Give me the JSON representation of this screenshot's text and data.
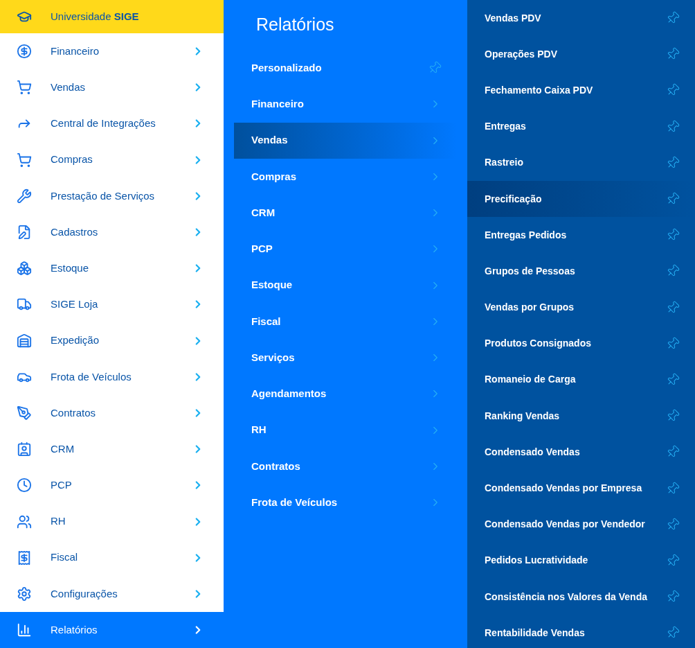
{
  "sidebar": {
    "header": {
      "label": "Universidade **SIGE**"
    },
    "items": [
      {
        "label": "Financeiro",
        "selected": false
      },
      {
        "label": "Vendas",
        "selected": false
      },
      {
        "label": "Central de Integrações",
        "selected": false
      },
      {
        "label": "Compras",
        "selected": false
      },
      {
        "label": "Prestação de Serviços",
        "selected": false
      },
      {
        "label": "Cadastros",
        "selected": false
      },
      {
        "label": "Estoque",
        "selected": false
      },
      {
        "label": "SIGE Loja",
        "selected": false
      },
      {
        "label": "Expedição",
        "selected": false
      },
      {
        "label": "Frota de Veículos",
        "selected": false
      },
      {
        "label": "Contratos",
        "selected": false
      },
      {
        "label": "CRM",
        "selected": false
      },
      {
        "label": "PCP",
        "selected": false
      },
      {
        "label": "RH",
        "selected": false
      },
      {
        "label": "Fiscal",
        "selected": false
      },
      {
        "label": "Configurações",
        "selected": false
      },
      {
        "label": "Relatórios",
        "selected": true
      }
    ]
  },
  "submenu": {
    "title": "Relatórios",
    "items": [
      {
        "label": "Personalizado",
        "kind": "pin",
        "selected": false
      },
      {
        "label": "Financeiro",
        "kind": "folder",
        "selected": false
      },
      {
        "label": "Vendas",
        "kind": "folder",
        "selected": true
      },
      {
        "label": "Compras",
        "kind": "folder",
        "selected": false
      },
      {
        "label": "CRM",
        "kind": "folder",
        "selected": false
      },
      {
        "label": "PCP",
        "kind": "folder",
        "selected": false
      },
      {
        "label": "Estoque",
        "kind": "folder",
        "selected": false
      },
      {
        "label": "Fiscal",
        "kind": "folder",
        "selected": false
      },
      {
        "label": "Serviços",
        "kind": "folder",
        "selected": false
      },
      {
        "label": "Agendamentos",
        "kind": "folder",
        "selected": false
      },
      {
        "label": "RH",
        "kind": "folder",
        "selected": false
      },
      {
        "label": "Contratos",
        "kind": "folder",
        "selected": false
      },
      {
        "label": "Frota de Veículos",
        "kind": "folder",
        "selected": false
      }
    ]
  },
  "reports": {
    "items": [
      {
        "label": "Vendas PDV",
        "selected": false
      },
      {
        "label": "Operações PDV",
        "selected": false
      },
      {
        "label": "Fechamento Caixa PDV",
        "selected": false
      },
      {
        "label": "Entregas",
        "selected": false
      },
      {
        "label": "Rastreio",
        "selected": false
      },
      {
        "label": "Precificação",
        "selected": true
      },
      {
        "label": "Entregas Pedidos",
        "selected": false
      },
      {
        "label": "Grupos de Pessoas",
        "selected": false
      },
      {
        "label": "Vendas por Grupos",
        "selected": false
      },
      {
        "label": "Produtos Consignados",
        "selected": false
      },
      {
        "label": "Romaneio de Carga",
        "selected": false
      },
      {
        "label": "Ranking Vendas",
        "selected": false
      },
      {
        "label": "Condensado Vendas",
        "selected": false
      },
      {
        "label": "Condensado Vendas por Empresa",
        "selected": false
      },
      {
        "label": "Condensado Vendas por Vendedor",
        "selected": false
      },
      {
        "label": "Pedidos Lucratividade",
        "selected": false
      },
      {
        "label": "Consistência nos Valores da Venda",
        "selected": false
      },
      {
        "label": "Rentabilidade Vendas",
        "selected": false
      }
    ]
  }
}
